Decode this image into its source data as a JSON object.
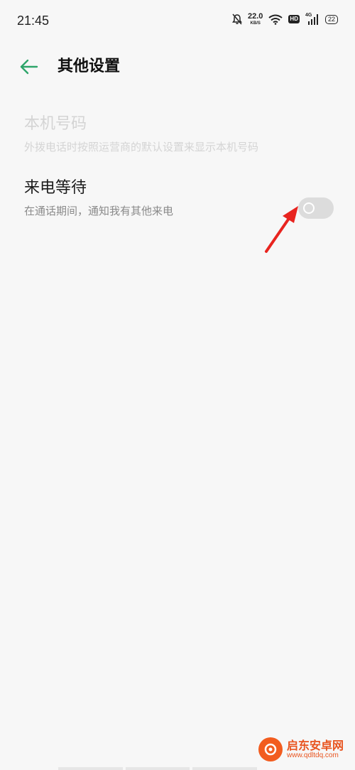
{
  "status_bar": {
    "time": "21:45",
    "network_speed": "22.0",
    "network_speed_unit": "KB/S",
    "hd_label": "HD",
    "signal_label": "4G",
    "battery_level": "22",
    "icons": [
      "bell-off-icon",
      "wifi-icon",
      "hd-icon",
      "signal-icon",
      "battery-icon"
    ]
  },
  "header": {
    "back_icon": "arrow-left-icon",
    "title": "其他设置"
  },
  "settings": [
    {
      "title": "本机号码",
      "description": "外拨电话时按照运营商的默认设置来显示本机号码",
      "enabled": false
    },
    {
      "title": "来电等待",
      "description": "在通话期间，通知我有其他来电",
      "enabled": true,
      "toggle_on": false
    }
  ],
  "watermark": {
    "name": "启东安卓网",
    "url": "www.qdltdq.com"
  },
  "colors": {
    "accent": "#2ea56a",
    "background": "#f7f7f7",
    "annotation_arrow": "#e8241f",
    "toggle_off": "#dcdcdc"
  }
}
